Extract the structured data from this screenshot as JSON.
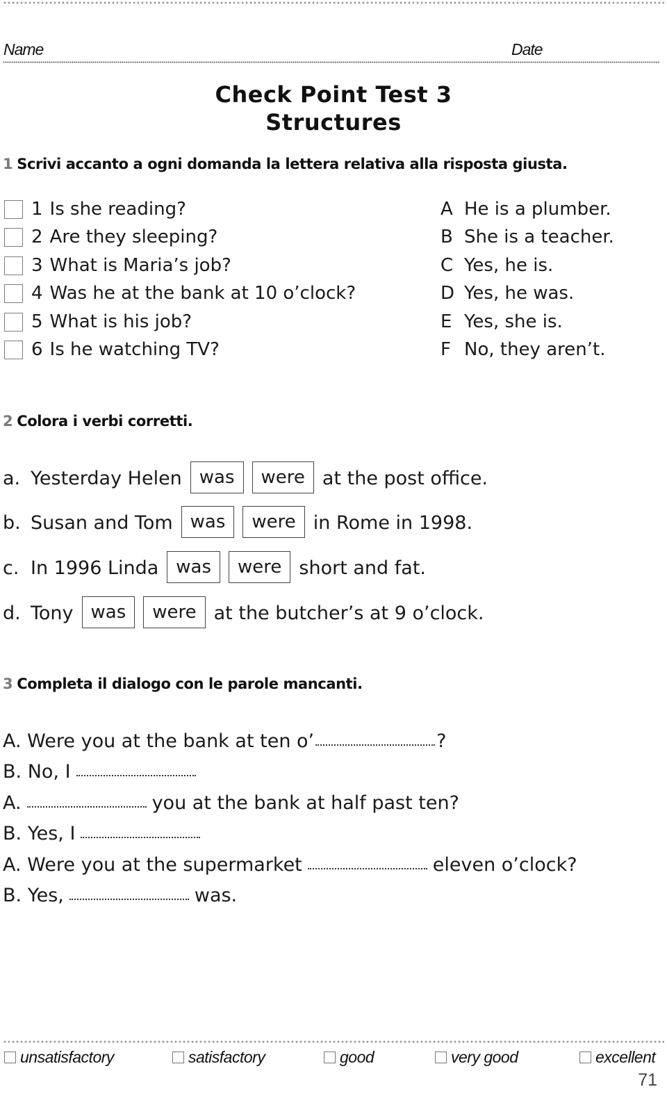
{
  "header": {
    "name_label": "Name",
    "date_label": "Date",
    "title_line1": "Check Point Test 3",
    "title_line2": "Structures"
  },
  "exercise1": {
    "number": "1",
    "instruction": "Scrivi accanto a ogni domanda la lettera relativa alla risposta giusta.",
    "questions": [
      {
        "num": "1",
        "text": "Is she reading?"
      },
      {
        "num": "2",
        "text": "Are they sleeping?"
      },
      {
        "num": "3",
        "text": "What is Maria’s job?"
      },
      {
        "num": "4",
        "text": "Was he at the bank at 10 o’clock?"
      },
      {
        "num": "5",
        "text": "What is his job?"
      },
      {
        "num": "6",
        "text": "Is he watching TV?"
      }
    ],
    "answers": [
      {
        "letter": "A",
        "text": "He is a plumber."
      },
      {
        "letter": "B",
        "text": "She is a teacher."
      },
      {
        "letter": "C",
        "text": "Yes, he is."
      },
      {
        "letter": "D",
        "text": "Yes, he was."
      },
      {
        "letter": "E",
        "text": "Yes, she is."
      },
      {
        "letter": "F",
        "text": "No, they aren’t."
      }
    ]
  },
  "exercise2": {
    "number": "2",
    "instruction": "Colora i verbi corretti.",
    "option1": "was",
    "option2": "were",
    "items": [
      {
        "label": "a.",
        "before": "Yesterday Helen",
        "after": "at the post office."
      },
      {
        "label": "b.",
        "before": "Susan and Tom",
        "after": "in Rome in 1998."
      },
      {
        "label": "c.",
        "before": "In 1996 Linda",
        "after": "short and fat."
      },
      {
        "label": "d.",
        "before": "Tony",
        "after": "at the butcher’s at 9 o’clock."
      }
    ]
  },
  "exercise3": {
    "number": "3",
    "instruction": "Completa il dialogo con le parole mancanti.",
    "lines": [
      {
        "before": "A. Were you at the bank at ten o’",
        "after": "?"
      },
      {
        "before": "B. No, I",
        "after": ""
      },
      {
        "before": "A.",
        "after": "you at the bank at half past ten?"
      },
      {
        "before": "B. Yes, I",
        "after": ""
      },
      {
        "before": "A. Were you at the supermarket",
        "after": "eleven o’clock?"
      },
      {
        "before": "B. Yes,",
        "after": "was."
      }
    ]
  },
  "footer": {
    "ratings": [
      "unsatisfactory",
      "satisfactory",
      "good",
      "very good",
      "excellent"
    ],
    "page_number": "71"
  }
}
